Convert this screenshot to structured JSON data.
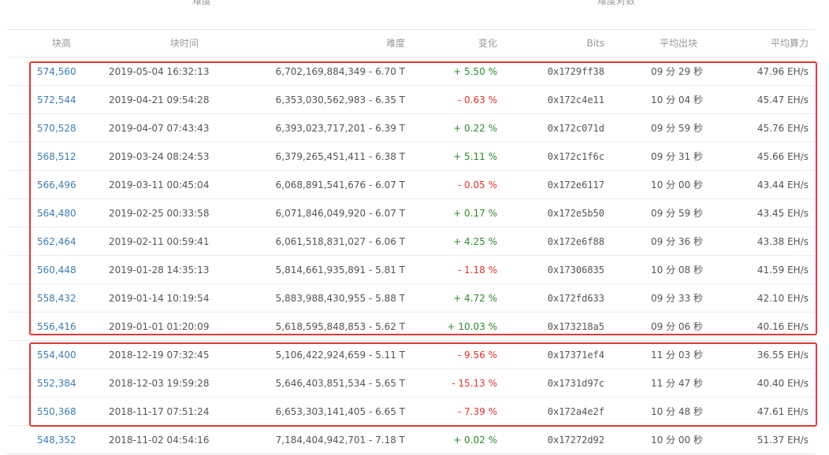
{
  "top_labels": {
    "left": "难度",
    "right": "难度对数"
  },
  "headers": {
    "height": "块高",
    "time": "块时间",
    "difficulty": "难度",
    "change": "变化",
    "bits": "Bits",
    "avg_block_time": "平均出块",
    "avg_hashrate": "平均算力"
  },
  "rows": [
    {
      "height": "574,560",
      "time": "2019-05-04 16:32:13",
      "difficulty": "6,702,169,884,349 - 6.70 T",
      "change": "+ 5.50 %",
      "change_dir": "pos",
      "bits": "0x1729ff38",
      "avg_block_time": "09 分 29 秒",
      "avg_hashrate": "47.96 EH/s"
    },
    {
      "height": "572,544",
      "time": "2019-04-21 09:54:28",
      "difficulty": "6,353,030,562,983 - 6.35 T",
      "change": "- 0.63 %",
      "change_dir": "neg",
      "bits": "0x172c4e11",
      "avg_block_time": "10 分 04 秒",
      "avg_hashrate": "45.47 EH/s"
    },
    {
      "height": "570,528",
      "time": "2019-04-07 07:43:43",
      "difficulty": "6,393,023,717,201 - 6.39 T",
      "change": "+ 0.22 %",
      "change_dir": "pos",
      "bits": "0x172c071d",
      "avg_block_time": "09 分 59 秒",
      "avg_hashrate": "45.76 EH/s"
    },
    {
      "height": "568,512",
      "time": "2019-03-24 08:24:53",
      "difficulty": "6,379,265,451,411 - 6.38 T",
      "change": "+ 5.11 %",
      "change_dir": "pos",
      "bits": "0x172c1f6c",
      "avg_block_time": "09 分 31 秒",
      "avg_hashrate": "45.66 EH/s"
    },
    {
      "height": "566,496",
      "time": "2019-03-11 00:45:04",
      "difficulty": "6,068,891,541,676 - 6.07 T",
      "change": "- 0.05 %",
      "change_dir": "neg",
      "bits": "0x172e6117",
      "avg_block_time": "10 分 00 秒",
      "avg_hashrate": "43.44 EH/s"
    },
    {
      "height": "564,480",
      "time": "2019-02-25 00:33:58",
      "difficulty": "6,071,846,049,920 - 6.07 T",
      "change": "+ 0.17 %",
      "change_dir": "pos",
      "bits": "0x172e5b50",
      "avg_block_time": "09 分 59 秒",
      "avg_hashrate": "43.45 EH/s"
    },
    {
      "height": "562,464",
      "time": "2019-02-11 00:59:41",
      "difficulty": "6,061,518,831,027 - 6.06 T",
      "change": "+ 4.25 %",
      "change_dir": "pos",
      "bits": "0x172e6f88",
      "avg_block_time": "09 分 36 秒",
      "avg_hashrate": "43.38 EH/s"
    },
    {
      "height": "560,448",
      "time": "2019-01-28 14:35:13",
      "difficulty": "5,814,661,935,891 - 5.81 T",
      "change": "- 1.18 %",
      "change_dir": "neg",
      "bits": "0x17306835",
      "avg_block_time": "10 分 08 秒",
      "avg_hashrate": "41.59 EH/s"
    },
    {
      "height": "558,432",
      "time": "2019-01-14 10:19:54",
      "difficulty": "5,883,988,430,955 - 5.88 T",
      "change": "+ 4.72 %",
      "change_dir": "pos",
      "bits": "0x172fd633",
      "avg_block_time": "09 分 33 秒",
      "avg_hashrate": "42.10 EH/s"
    },
    {
      "height": "556,416",
      "time": "2019-01-01 01:20:09",
      "difficulty": "5,618,595,848,853 - 5.62 T",
      "change": "+ 10.03 %",
      "change_dir": "pos",
      "bits": "0x173218a5",
      "avg_block_time": "09 分 06 秒",
      "avg_hashrate": "40.16 EH/s"
    },
    {
      "height": "554,400",
      "time": "2018-12-19 07:32:45",
      "difficulty": "5,106,422,924,659 - 5.11 T",
      "change": "- 9.56 %",
      "change_dir": "neg",
      "bits": "0x17371ef4",
      "avg_block_time": "11 分 03 秒",
      "avg_hashrate": "36.55 EH/s"
    },
    {
      "height": "552,384",
      "time": "2018-12-03 19:59:28",
      "difficulty": "5,646,403,851,534 - 5.65 T",
      "change": "- 15.13 %",
      "change_dir": "neg",
      "bits": "0x1731d97c",
      "avg_block_time": "11 分 47 秒",
      "avg_hashrate": "40.40 EH/s"
    },
    {
      "height": "550,368",
      "time": "2018-11-17 07:51:24",
      "difficulty": "6,653,303,141,405 - 6.65 T",
      "change": "- 7.39 %",
      "change_dir": "neg",
      "bits": "0x172a4e2f",
      "avg_block_time": "10 分 48 秒",
      "avg_hashrate": "47.61 EH/s"
    },
    {
      "height": "548,352",
      "time": "2018-11-02 04:54:16",
      "difficulty": "7,184,404,942,701 - 7.18 T",
      "change": "+ 0.02 %",
      "change_dir": "pos",
      "bits": "0x17272d92",
      "avg_block_time": "10 分 00 秒",
      "avg_hashrate": "51.37 EH/s"
    }
  ],
  "highlight_color": "#e03a36",
  "positive_color": "#2e8b2e",
  "negative_color": "#e2322d",
  "link_color": "#3e7cb1"
}
